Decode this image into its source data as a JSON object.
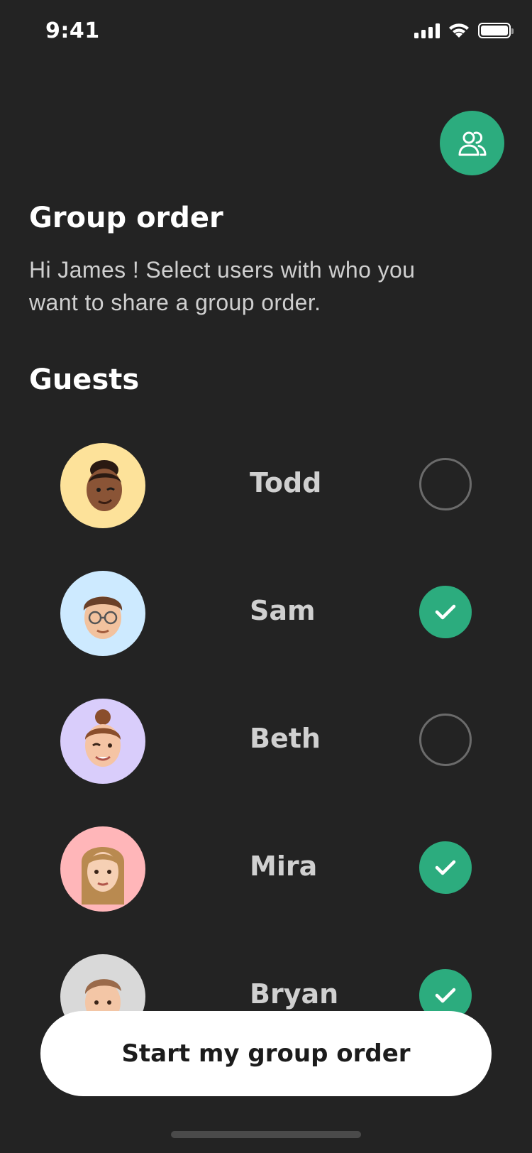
{
  "status_bar": {
    "time": "9:41",
    "icons": [
      "signal-icon",
      "wifi-icon",
      "battery-icon"
    ]
  },
  "header": {
    "group_button_icon": "group-users-icon",
    "title": "Group order",
    "subtitle": "Hi James ! Select users with who you want to share a group order."
  },
  "guests_section": {
    "title": "Guests",
    "items": [
      {
        "name": "Todd",
        "selected": false,
        "avatar_bg": "#fde29a"
      },
      {
        "name": "Sam",
        "selected": true,
        "avatar_bg": "#cdeaff"
      },
      {
        "name": "Beth",
        "selected": false,
        "avatar_bg": "#d9cdfb"
      },
      {
        "name": "Mira",
        "selected": true,
        "avatar_bg": "#ffb6b9"
      },
      {
        "name": "Bryan",
        "selected": true,
        "avatar_bg": "#d9d9d9"
      }
    ]
  },
  "cta": {
    "label": "Start my group order"
  },
  "colors": {
    "background": "#232323",
    "accent": "#2cac7e",
    "unselected_ring": "#6b6b6b",
    "cta_bg": "#ffffff"
  }
}
